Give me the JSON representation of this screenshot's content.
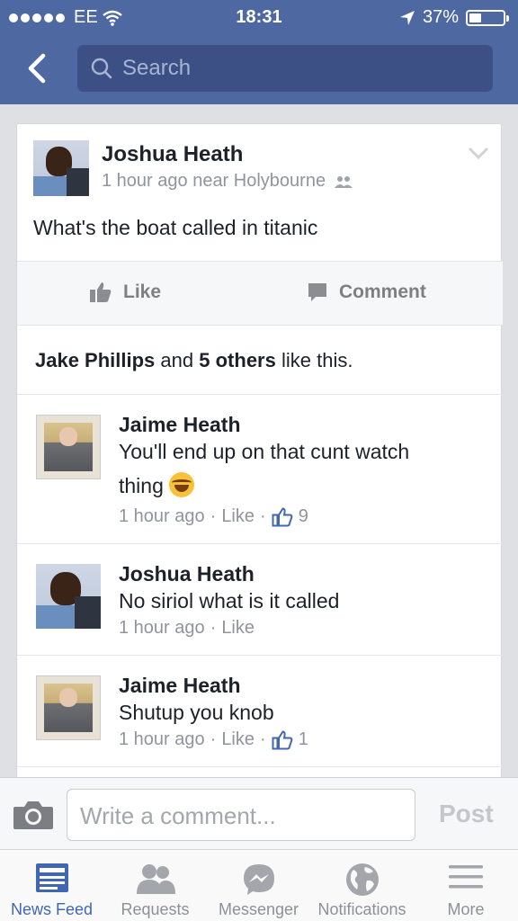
{
  "status_bar": {
    "carrier": "EE",
    "time": "18:31",
    "battery": "37%",
    "battery_level": 0.37
  },
  "header": {
    "search_placeholder": "Search"
  },
  "post": {
    "author": "Joshua Heath",
    "meta": "1 hour ago near Holybourne",
    "text": "What's the boat called in titanic",
    "like_label": "Like",
    "comment_label": "Comment",
    "likes_summary": {
      "name": "Jake Phillips",
      "and": "and",
      "others": "5 others",
      "suffix": "like this."
    }
  },
  "comments": [
    {
      "author": "Jaime Heath",
      "text_line1": "You'll end up on that cunt watch",
      "text_line2": "thing",
      "time": "1 hour ago",
      "sep": "·",
      "like": "Like",
      "likes": "9"
    },
    {
      "author": "Joshua Heath",
      "text_line1": "No siriol what is it called",
      "time": "1 hour ago",
      "sep": "·",
      "like": "Like"
    },
    {
      "author": "Jaime Heath",
      "text_line1": "Shutup you knob",
      "time": "1 hour ago",
      "sep": "·",
      "like": "Like",
      "likes": "1"
    }
  ],
  "composer": {
    "placeholder": "Write a comment...",
    "post_label": "Post"
  },
  "tabbar": {
    "items": [
      {
        "label": "News Feed",
        "icon": "news-feed-icon",
        "active": true
      },
      {
        "label": "Requests",
        "icon": "friend-requests-icon"
      },
      {
        "label": "Messenger",
        "icon": "messenger-icon"
      },
      {
        "label": "Notifications",
        "icon": "globe-icon"
      },
      {
        "label": "More",
        "icon": "menu-icon"
      }
    ]
  },
  "colors": {
    "header_blue": "#4e69a2",
    "search_bg": "#3c5086",
    "accent": "#4267b2"
  }
}
